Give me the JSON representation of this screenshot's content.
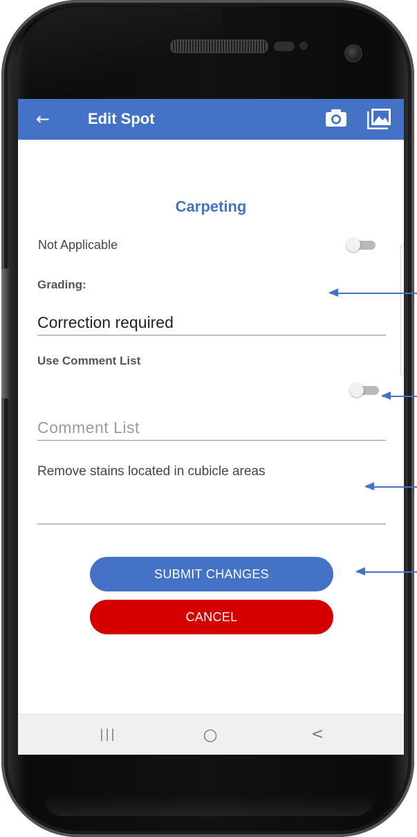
{
  "app_bar": {
    "title": "Edit Spot",
    "back_icon": "arrow-left-icon",
    "actions": [
      "camera-icon",
      "gallery-icon"
    ],
    "color": "#4472c4"
  },
  "form": {
    "section_title": "Carpeting",
    "not_applicable_label": "Not Applicable",
    "not_applicable_on": false,
    "grading_label": "Grading:",
    "grading_value": "Correction required",
    "use_comment_list_label": "Use Comment List",
    "use_comment_list_on": false,
    "comment_list_placeholder": "Comment List",
    "notes_value": "Remove stains located in cubicle areas"
  },
  "buttons": {
    "submit_label": "SUBMIT CHANGES",
    "submit_color": "#4472c4",
    "cancel_label": "CANCEL",
    "cancel_color": "#d40000"
  },
  "nav_bar": {
    "recents": "|||",
    "home": "○",
    "back": "<"
  }
}
